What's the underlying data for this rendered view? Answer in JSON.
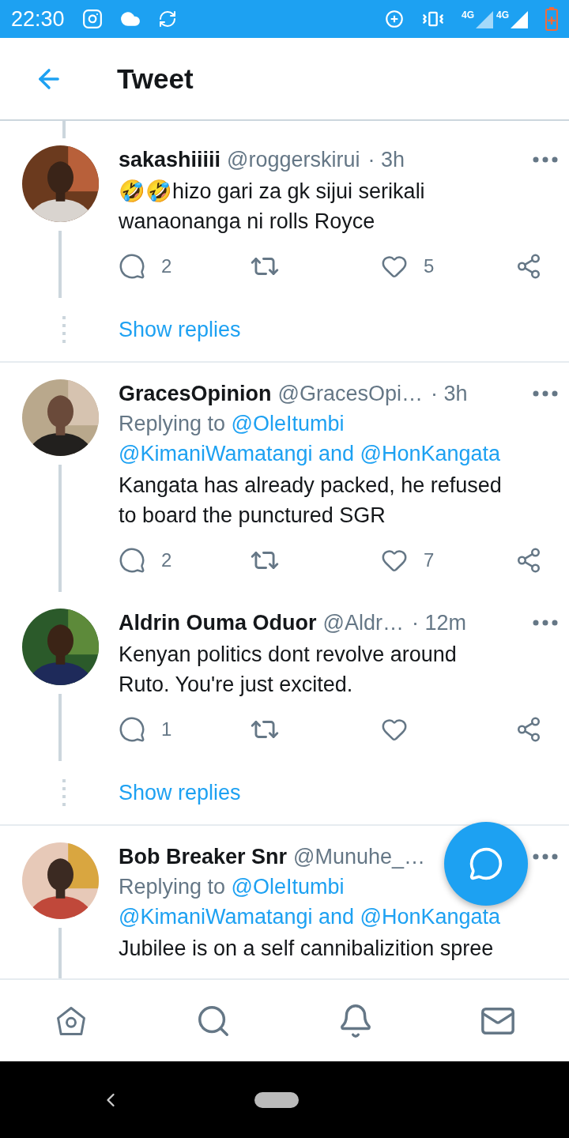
{
  "status_bar": {
    "time": "22:30",
    "network_labels": [
      "4G",
      "4G"
    ]
  },
  "header": {
    "title": "Tweet"
  },
  "threads": [
    {
      "tweets": [
        {
          "name": "sakashiiiii",
          "handle": "@roggerskirui",
          "time": "· 3h",
          "text": "🤣🤣hizo gari za gk sijui serikali\nwanaonanga ni rolls Royce",
          "replies": "2",
          "likes": "5"
        }
      ],
      "show_replies": "Show replies"
    },
    {
      "tweets": [
        {
          "name": "GracesOpinion",
          "handle": "@GracesOpi…",
          "time": "· 3h",
          "replying": {
            "label": "Replying to",
            "first": "@OleItumbi",
            "rest": "@KimaniWamatangi and @HonKangata"
          },
          "text": "Kangata has already packed, he refused\nto board the punctured SGR",
          "replies": "2",
          "likes": "7"
        },
        {
          "name": "Aldrin Ouma Oduor",
          "handle": "@Aldr…",
          "time": "· 12m",
          "text": "Kenyan politics dont revolve around\nRuto. You're just excited.",
          "replies": "1"
        }
      ],
      "show_replies": "Show replies"
    },
    {
      "tweets": [
        {
          "name": "Bob Breaker Snr",
          "handle": "@Munuhe_…",
          "replying": {
            "label": "Replying to",
            "first": "@OleItumbi",
            "rest": "@KimaniWamatangi and @HonKangata"
          },
          "text": "Jubilee is on a self cannibalizition spree"
        }
      ]
    }
  ]
}
